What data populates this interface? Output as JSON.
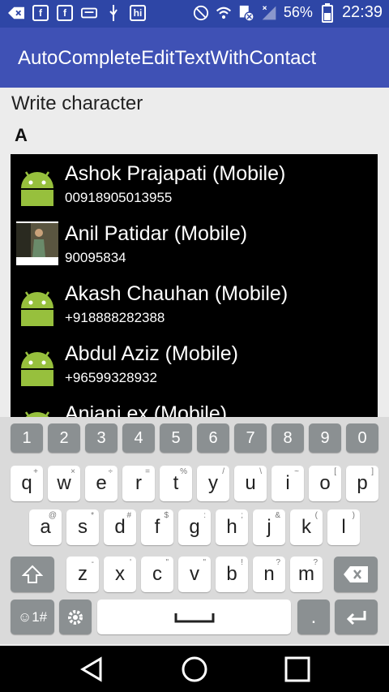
{
  "status_bar": {
    "battery_text": "56%",
    "time": "22:39",
    "icons": [
      "back-arrow-icon",
      "facebook-icon",
      "facebook-icon",
      "keyboard-icon",
      "usb-icon",
      "hike-icon",
      "mute-icon",
      "wifi-icon",
      "sim-icon",
      "signal-icon",
      "battery-icon"
    ],
    "hike_label": "hi",
    "fb_label": "f"
  },
  "app_bar": {
    "title": "AutoCompleteEditTextWithContact"
  },
  "form": {
    "label": "Write character",
    "input_value": "A"
  },
  "contacts": [
    {
      "name": "Ashok Prajapati (Mobile)",
      "number": "00918905013955",
      "avatar": "android"
    },
    {
      "name": "Anil Patidar (Mobile)",
      "number": "90095834",
      "avatar": "photo"
    },
    {
      "name": "Akash Chauhan (Mobile)",
      "number": "+918888282388",
      "avatar": "android"
    },
    {
      "name": "Abdul Aziz (Mobile)",
      "number": "+96599328932",
      "avatar": "android"
    },
    {
      "name": "Anjani ex (Mobile)",
      "number": "",
      "avatar": "android"
    }
  ],
  "keyboard": {
    "numbers": [
      "1",
      "2",
      "3",
      "4",
      "5",
      "6",
      "7",
      "8",
      "9",
      "0"
    ],
    "row1": [
      {
        "k": "q",
        "h": "+"
      },
      {
        "k": "w",
        "h": "×"
      },
      {
        "k": "e",
        "h": "÷"
      },
      {
        "k": "r",
        "h": "="
      },
      {
        "k": "t",
        "h": "%"
      },
      {
        "k": "y",
        "h": "/"
      },
      {
        "k": "u",
        "h": "\\"
      },
      {
        "k": "i",
        "h": "~"
      },
      {
        "k": "o",
        "h": "["
      },
      {
        "k": "p",
        "h": "]"
      }
    ],
    "row2": [
      {
        "k": "a",
        "h": "@"
      },
      {
        "k": "s",
        "h": "*"
      },
      {
        "k": "d",
        "h": "#"
      },
      {
        "k": "f",
        "h": "$"
      },
      {
        "k": "g",
        "h": ":"
      },
      {
        "k": "h",
        "h": ";"
      },
      {
        "k": "j",
        "h": "&"
      },
      {
        "k": "k",
        "h": "("
      },
      {
        "k": "l",
        "h": ")"
      }
    ],
    "row3": [
      {
        "k": "z",
        "h": "-"
      },
      {
        "k": "x",
        "h": "'"
      },
      {
        "k": "c",
        "h": "\""
      },
      {
        "k": "v",
        "h": "\""
      },
      {
        "k": "b",
        "h": "!"
      },
      {
        "k": "n",
        "h": "?"
      },
      {
        "k": "m",
        "h": "?"
      }
    ],
    "symbols_label": "☺1#",
    "period_label": "."
  }
}
